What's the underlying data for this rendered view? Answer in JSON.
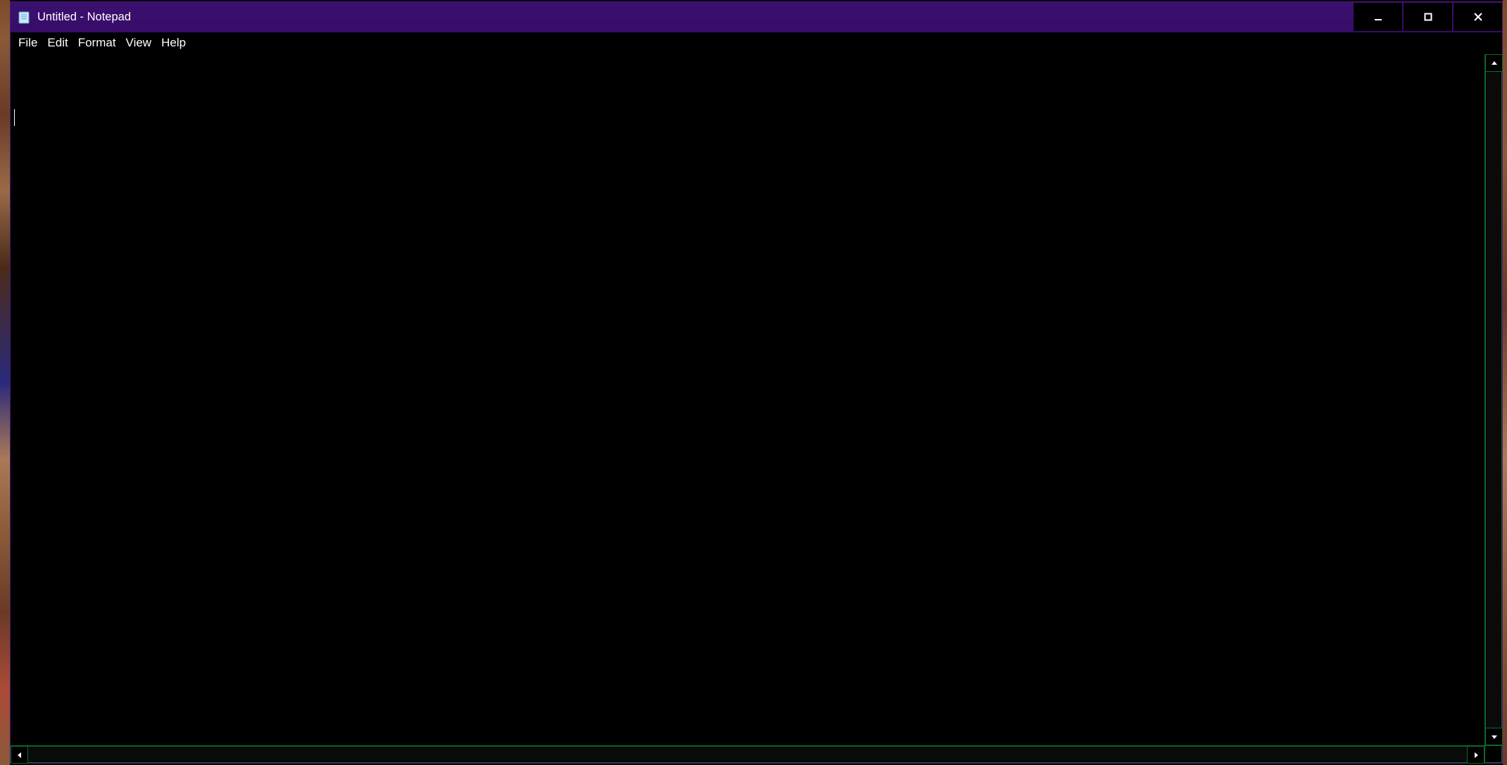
{
  "window": {
    "title": "Untitled - Notepad"
  },
  "menu": {
    "items": [
      "File",
      "Edit",
      "Format",
      "View",
      "Help"
    ]
  },
  "editor": {
    "content": ""
  },
  "colors": {
    "titlebar": "#380c68",
    "background": "#000000",
    "scrollbar_border": "#0a6a2a",
    "text": "#ffffff"
  }
}
